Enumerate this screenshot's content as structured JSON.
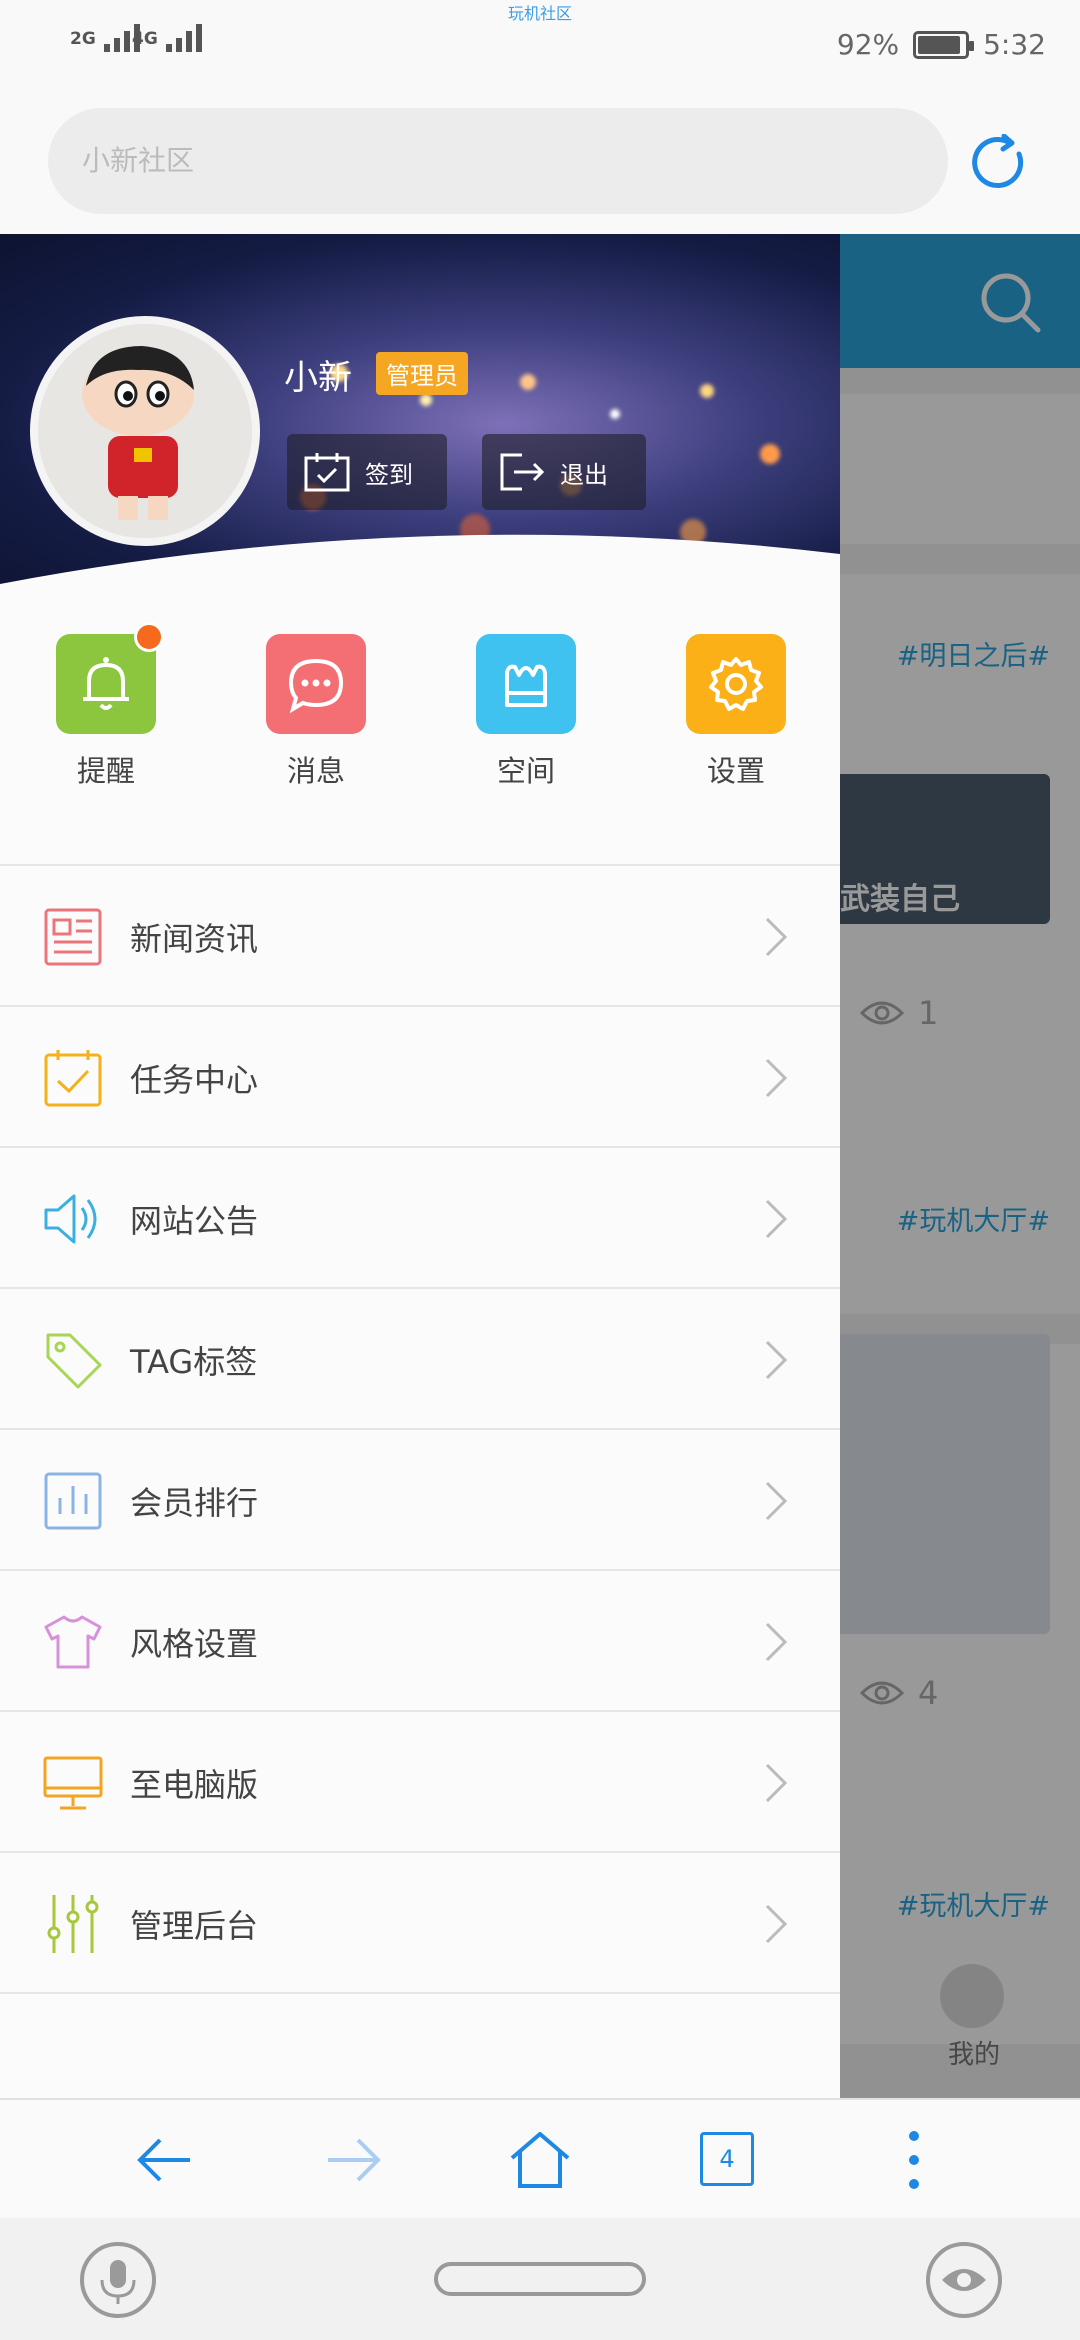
{
  "status_bar": {
    "app_title": "玩机社区",
    "signal_1": "2G",
    "signal_2": "4G",
    "battery_percent": "92%",
    "battery_level": 0.92,
    "time": "5:32"
  },
  "url_bar": {
    "placeholder": "小新社区"
  },
  "background_page": {
    "tags": [
      "#明日之后#",
      "#玩机大厅#",
      "#玩机大厅#"
    ],
    "view_counts": [
      "1",
      "4"
    ],
    "image_caption": "武装自己",
    "mine_label": "我的"
  },
  "profile": {
    "username": "小新",
    "role_badge": "管理员",
    "sign_in_label": "签到",
    "logout_label": "退出"
  },
  "quick_actions": [
    {
      "label": "提醒",
      "color": "#8cc63f",
      "icon": "bell-icon",
      "has_badge": true
    },
    {
      "label": "消息",
      "color": "#f36f73",
      "icon": "chat-icon"
    },
    {
      "label": "空间",
      "color": "#3fc2f0",
      "icon": "crown-icon"
    },
    {
      "label": "设置",
      "color": "#fbb017",
      "icon": "gear-icon"
    }
  ],
  "menu": [
    {
      "label": "新闻资讯",
      "icon": "newspaper-icon",
      "color": "#e8767a"
    },
    {
      "label": "任务中心",
      "icon": "task-check-icon",
      "color": "#f3b21a"
    },
    {
      "label": "网站公告",
      "icon": "speaker-icon",
      "color": "#3ab0e2"
    },
    {
      "label": "TAG标签",
      "icon": "tag-icon",
      "color": "#a6d653"
    },
    {
      "label": "会员排行",
      "icon": "bar-chart-icon",
      "color": "#8ab4e6"
    },
    {
      "label": "风格设置",
      "icon": "tshirt-icon",
      "color": "#d890d8"
    },
    {
      "label": "至电脑版",
      "icon": "monitor-icon",
      "color": "#f3a521"
    },
    {
      "label": "管理后台",
      "icon": "sliders-icon",
      "color": "#a6c83a"
    }
  ],
  "nav": {
    "tab_count": "4"
  },
  "colors": {
    "accent": "#2aa3dc",
    "nav_blue": "#1e88e5"
  }
}
